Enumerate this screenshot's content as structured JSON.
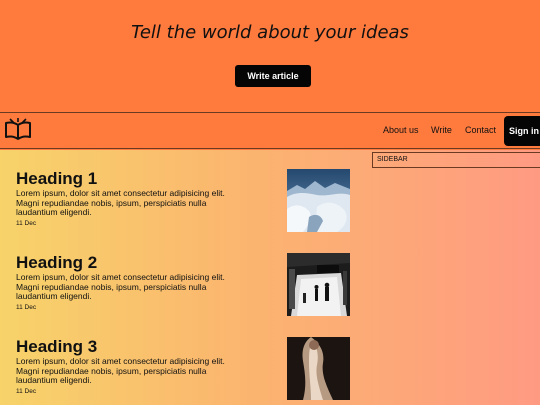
{
  "hero": {
    "title": "Tell the world about your ideas",
    "cta": "Write article"
  },
  "nav": {
    "logo": "open-book-icon",
    "links": [
      "About us",
      "Write",
      "Contact"
    ],
    "signin": "Sign in"
  },
  "sidebar": {
    "label": "SIDEBAR"
  },
  "articles": [
    {
      "heading": "Heading 1",
      "excerpt": "Lorem ipsum, dolor sit amet consectetur adipisicing elit. Magni repudiandae nobis, ipsum, perspiciatis nulla laudantium eligendi.",
      "date": "11 Dec",
      "image": "snowy-landscape-image"
    },
    {
      "heading": "Heading 2",
      "excerpt": "Lorem ipsum, dolor sit amet consectetur adipisicing elit. Magni repudiandae nobis, ipsum, perspiciatis nulla laudantium eligendi.",
      "date": "11 Dec",
      "image": "photo-studio-image"
    },
    {
      "heading": "Heading 3",
      "excerpt": "Lorem ipsum, dolor sit amet consectetur adipisicing elit. Magni repudiandae nobis, ipsum, perspiciatis nulla laudantium eligendi.",
      "date": "11 Dec",
      "image": "veil-portrait-image"
    }
  ],
  "colors": {
    "header_bg": "#ff7a3d",
    "button_bg": "#050505",
    "gradient_left": "#f7d36a",
    "gradient_right": "#ff9a82"
  }
}
